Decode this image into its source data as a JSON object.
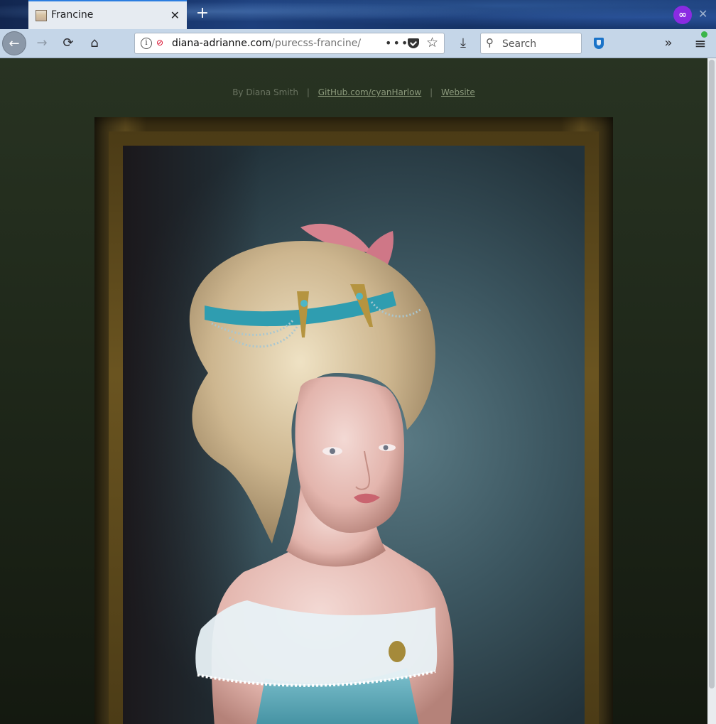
{
  "browser": {
    "tab": {
      "title": "Francine"
    },
    "private_icon_label": "∞",
    "url": {
      "host": "diana-adrianne.com",
      "path": "/purecss-francine/"
    },
    "search": {
      "placeholder": "Search"
    }
  },
  "page": {
    "credits": {
      "author": "By Diana Smith",
      "separator": "|",
      "github_link": "GitHub.com/cyanHarlow",
      "website_link": "Website"
    }
  },
  "icons": [
    "francine-favicon",
    "close-icon",
    "plus-icon",
    "private-browsing-icon",
    "back-arrow-icon",
    "forward-arrow-icon",
    "reload-icon",
    "home-icon",
    "info-icon",
    "insecure-connection-icon",
    "page-actions-icon",
    "pocket-icon",
    "bookmark-star-icon",
    "download-icon",
    "search-icon",
    "shield-extension-icon",
    "overflow-chevron-icon",
    "hamburger-menu-icon"
  ],
  "colors": {
    "accent": "#2b7de0",
    "page_background": "#283322",
    "frame": "#5c4a1e",
    "insecure": "#d70022"
  }
}
